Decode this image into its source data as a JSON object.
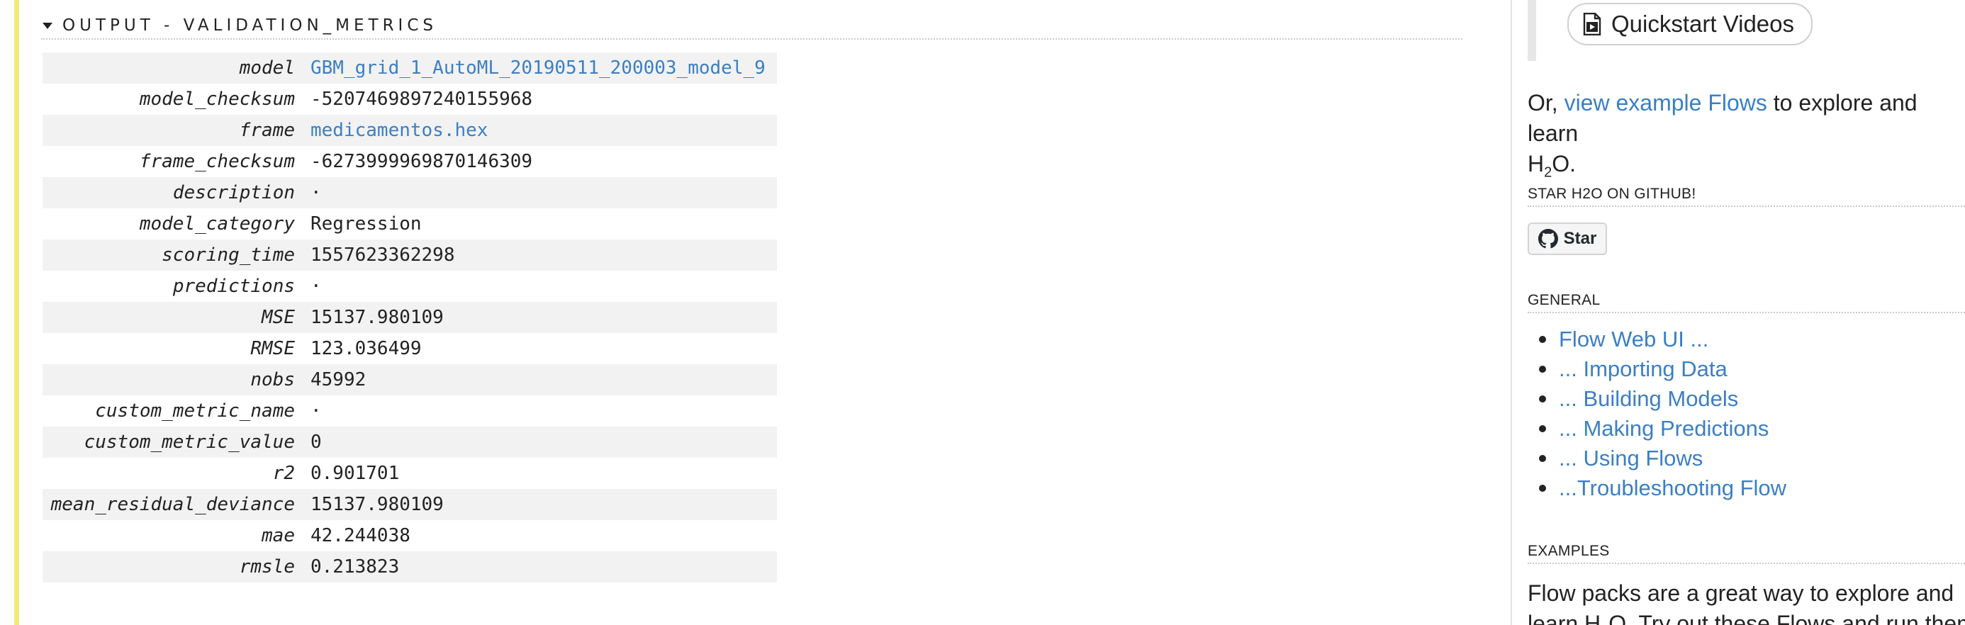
{
  "output_section": {
    "title": "OUTPUT - VALIDATION_METRICS",
    "rows": [
      {
        "key": "model",
        "value": "GBM_grid_1_AutoML_20190511_200003_model_9",
        "link": true
      },
      {
        "key": "model_checksum",
        "value": "-5207469897240155968",
        "link": false
      },
      {
        "key": "frame",
        "value": "medicamentos.hex",
        "link": true
      },
      {
        "key": "frame_checksum",
        "value": "-6273999969870146309",
        "link": false
      },
      {
        "key": "description",
        "value": "·",
        "link": false
      },
      {
        "key": "model_category",
        "value": "Regression",
        "link": false
      },
      {
        "key": "scoring_time",
        "value": "1557623362298",
        "link": false
      },
      {
        "key": "predictions",
        "value": "·",
        "link": false
      },
      {
        "key": "MSE",
        "value": "15137.980109",
        "link": false
      },
      {
        "key": "RMSE",
        "value": "123.036499",
        "link": false
      },
      {
        "key": "nobs",
        "value": "45992",
        "link": false
      },
      {
        "key": "custom_metric_name",
        "value": "·",
        "link": false
      },
      {
        "key": "custom_metric_value",
        "value": "0",
        "link": false
      },
      {
        "key": "r2",
        "value": "0.901701",
        "link": false
      },
      {
        "key": "mean_residual_deviance",
        "value": "15137.980109",
        "link": false
      },
      {
        "key": "mae",
        "value": "42.244038",
        "link": false
      },
      {
        "key": "rmsle",
        "value": "0.213823",
        "link": false
      }
    ]
  },
  "sidebar": {
    "quickstart_button": "Quickstart Videos",
    "intro": {
      "prefix": "Or, ",
      "link": "view example Flows",
      "suffix": " to explore and learn",
      "h": "H",
      "sub": "2",
      "o": "O."
    },
    "github_heading": "STAR H2O ON GITHUB!",
    "star_button": "Star",
    "general_heading": "GENERAL",
    "general_links": [
      "Flow Web UI ...",
      "... Importing Data",
      "... Building Models",
      "... Making Predictions",
      "... Using Flows",
      "...Troubleshooting Flow"
    ],
    "examples_heading": "EXAMPLES",
    "examples_line1": "Flow packs are a great way to explore and",
    "examples_line2_prefix": "learn H",
    "examples_line2_sub": "2",
    "examples_line2_suffix": "O. Try out these Flows and run them"
  },
  "colors": {
    "link": "#3b7fc4",
    "accent_bar": "#f4ea7a",
    "row_shade": "#f2f2f2"
  }
}
